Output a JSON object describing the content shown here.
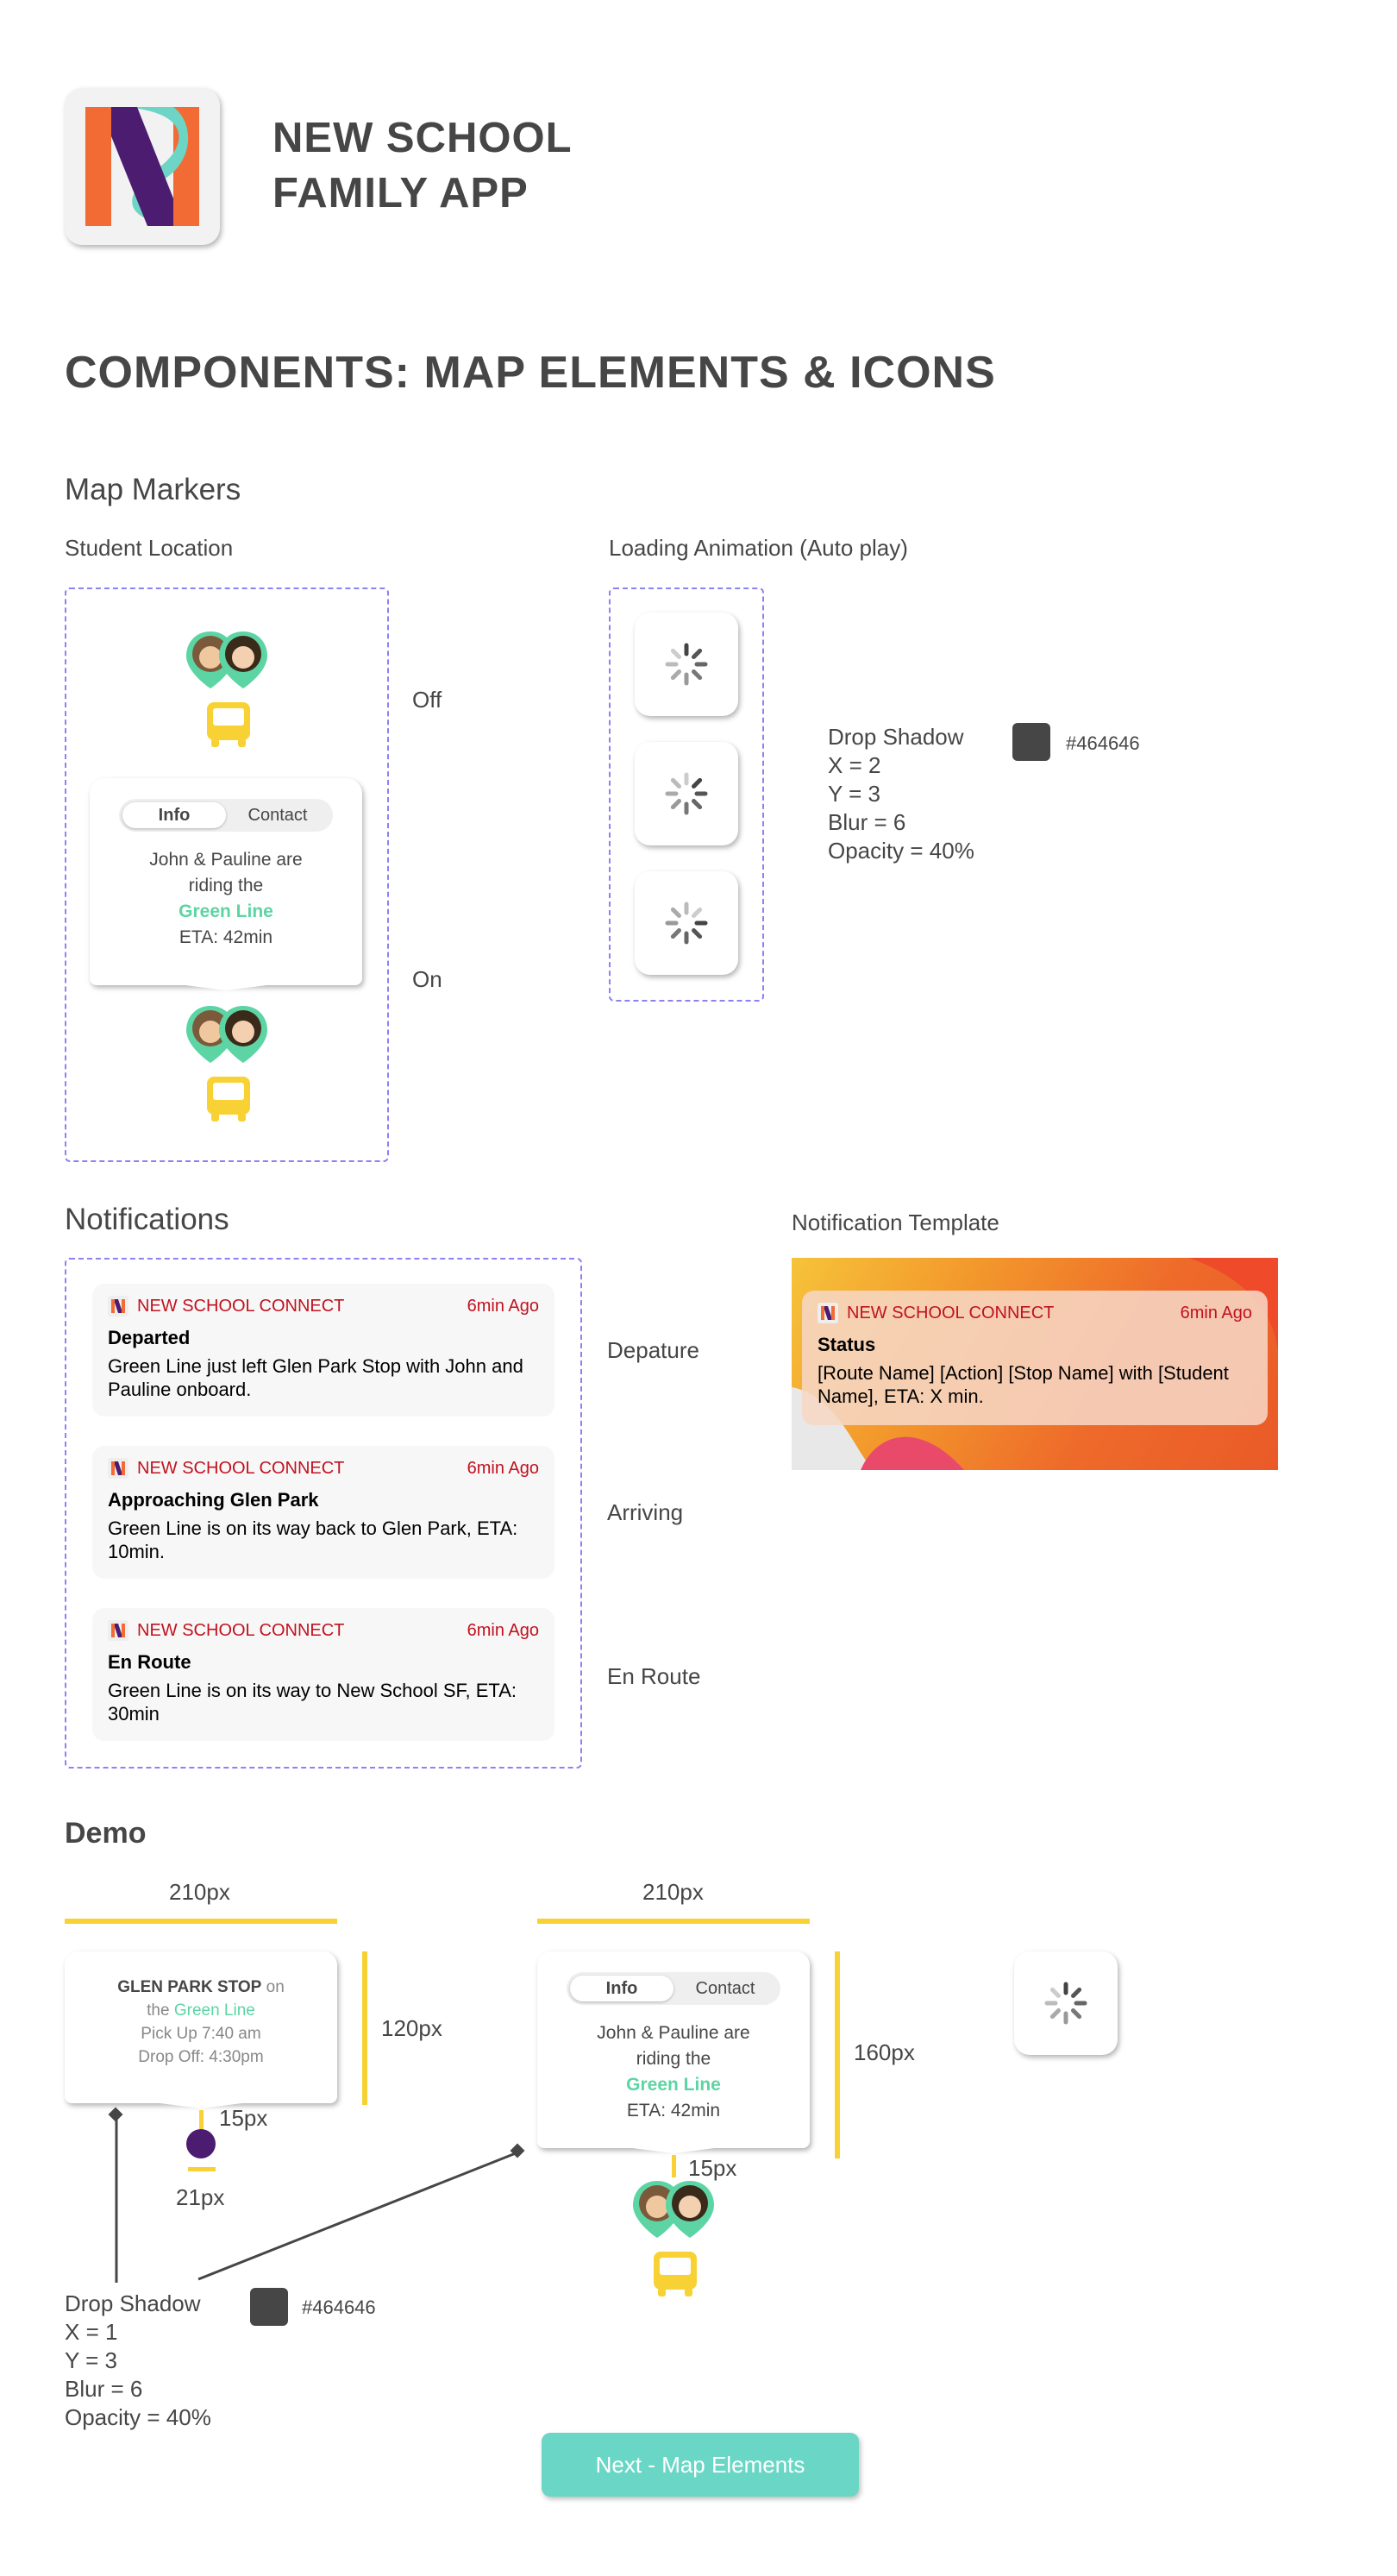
{
  "header": {
    "title_line1": "NEW SCHOOL",
    "title_line2": "FAMILY APP"
  },
  "section_title": "COMPONENTS: MAP ELEMENTS & ICONS",
  "map_markers": {
    "heading": "Map Markers",
    "student_location": "Student Location",
    "loading_animation": "Loading Animation (Auto play)",
    "state_off": "Off",
    "state_on": "On",
    "popup": {
      "tab_info": "Info",
      "tab_contact": "Contact",
      "line1": "John & Pauline are",
      "line2": "riding the",
      "line_name": "Green Line",
      "eta": "ETA: 42min"
    },
    "shadow": {
      "title": "Drop Shadow",
      "x": "X = 2",
      "y": "Y = 3",
      "blur": "Blur = 6",
      "opacity": "Opacity = 40%",
      "hex": "#464646"
    }
  },
  "notifications": {
    "heading": "Notifications",
    "template_label": "Notification Template",
    "items": [
      {
        "app": "NEW SCHOOL CONNECT",
        "time": "6min Ago",
        "title": "Departed",
        "body": "Green Line just left Glen Park Stop with John and Pauline onboard.",
        "label": "Depature"
      },
      {
        "app": "NEW SCHOOL CONNECT",
        "time": "6min Ago",
        "title": "Approaching Glen Park",
        "body": "Green Line is on its way back to Glen Park, ETA: 10min.",
        "label": "Arriving"
      },
      {
        "app": "NEW SCHOOL CONNECT",
        "time": "6min Ago",
        "title": "En Route",
        "body": "Green Line is on its way to New School SF, ETA: 30min",
        "label": "En Route"
      }
    ],
    "template": {
      "app": "NEW SCHOOL CONNECT",
      "time": "6min Ago",
      "title": "Status",
      "body": "[Route Name] [Action] [Stop Name] with [Student Name], ETA: X min."
    }
  },
  "demo": {
    "heading": "Demo",
    "dim_width_1": "210px",
    "dim_width_2": "210px",
    "dim_h1": "120px",
    "dim_h2": "160px",
    "dim_15a": "15px",
    "dim_15b": "15px",
    "dim_21": "21px",
    "stop_popup": {
      "stop": "GLEN PARK STOP",
      "on": "on",
      "the": "the",
      "line": "Green Line",
      "pickup": "Pick Up 7:40 am",
      "dropoff": "Drop Off: 4:30pm"
    },
    "shadow": {
      "title": "Drop Shadow",
      "x": "X = 1",
      "y": "Y = 3",
      "blur": "Blur = 6",
      "opacity": "Opacity = 40%",
      "hex": "#464646"
    }
  },
  "next_button": "Next - Map Elements",
  "colors": {
    "accent_green": "#5dd4a4",
    "bus_yellow": "#f8d234",
    "teal_button": "#6ad7c6",
    "shadow_gray": "#464646",
    "dashed": "#8b82f3",
    "notif_red": "#c1121f",
    "stop_purple": "#4b1c70"
  }
}
